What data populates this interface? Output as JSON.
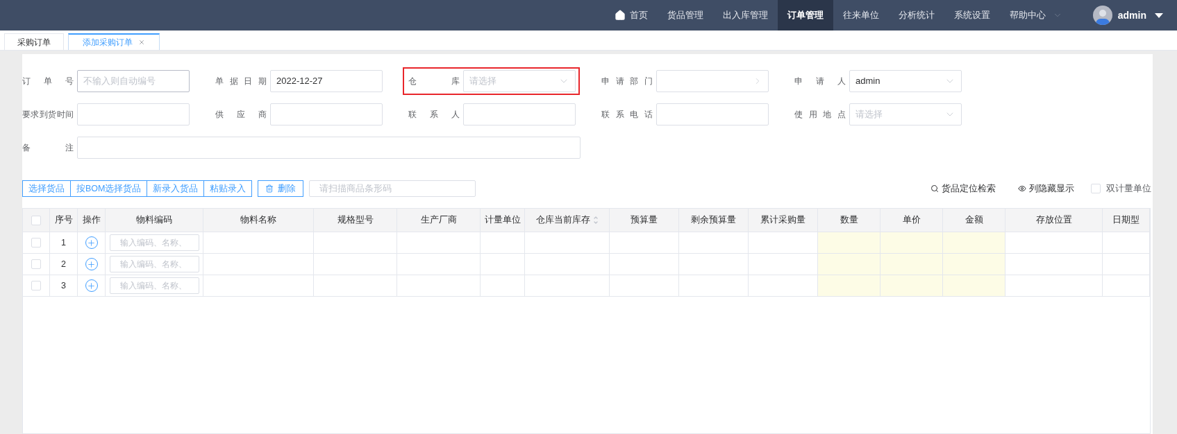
{
  "nav": {
    "items": [
      {
        "label": "首页",
        "kind": "home",
        "selected": false
      },
      {
        "label": "货品管理",
        "kind": "plain",
        "selected": false
      },
      {
        "label": "出入库管理",
        "kind": "plain",
        "selected": false
      },
      {
        "label": "订单管理",
        "kind": "plain",
        "selected": true
      },
      {
        "label": "往来单位",
        "kind": "plain",
        "selected": false
      },
      {
        "label": "分析统计",
        "kind": "plain",
        "selected": false
      },
      {
        "label": "系统设置",
        "kind": "plain",
        "selected": false
      },
      {
        "label": "帮助中心",
        "kind": "dropdown",
        "selected": false
      }
    ],
    "user": "admin"
  },
  "tabs": [
    {
      "label": "采购订单",
      "selected": false,
      "closable": false
    },
    {
      "label": "添加采购订单",
      "selected": true,
      "closable": true
    }
  ],
  "form": {
    "fields": [
      {
        "label": "订单号",
        "kind": "text",
        "placeholder": "不输入则自动编号",
        "highlighted": false
      },
      {
        "label": "单据日期",
        "kind": "text",
        "value": "2022-12-27",
        "highlighted": false
      },
      {
        "label": "仓库",
        "kind": "select",
        "placeholder": "请选择",
        "highlighted": true
      },
      {
        "label": "申请部门",
        "kind": "cascader",
        "highlighted": false
      },
      {
        "label": "申请人",
        "kind": "select",
        "value": "admin",
        "highlighted": false
      },
      {
        "label": "要求到货时间",
        "kind": "text",
        "highlighted": false
      },
      {
        "label": "供应商",
        "kind": "text",
        "highlighted": false
      },
      {
        "label": "联系人",
        "kind": "text",
        "highlighted": false
      },
      {
        "label": "联系电话",
        "kind": "text",
        "highlighted": false
      },
      {
        "label": "使用地点",
        "kind": "select",
        "placeholder": "请选择",
        "highlighted": false
      }
    ],
    "remark": {
      "label": "备注"
    }
  },
  "toolbar": {
    "buttons": [
      "选择货品",
      "按BOM选择货品",
      "新录入货品",
      "粘贴录入"
    ],
    "delete": "删除",
    "scan": {
      "placeholder": "请扫描商品条形码"
    },
    "locate": "货品定位检索",
    "columns_toggle": "列隐藏显示",
    "dual_unit": {
      "label": "双计量单位",
      "checked": false
    }
  },
  "table": {
    "select_all": {
      "checked": false
    },
    "columns": [
      {
        "label": "序号",
        "editable": false,
        "sortable": false
      },
      {
        "label": "操作",
        "editable": false,
        "sortable": false
      },
      {
        "label": "物料编码",
        "editable": false,
        "sortable": false
      },
      {
        "label": "物料名称",
        "editable": false,
        "sortable": false
      },
      {
        "label": "规格型号",
        "editable": false,
        "sortable": false
      },
      {
        "label": "生产厂商",
        "editable": false,
        "sortable": false
      },
      {
        "label": "计量单位",
        "editable": false,
        "sortable": false
      },
      {
        "label": "仓库当前库存",
        "editable": false,
        "sortable": true
      },
      {
        "label": "预算量",
        "editable": false,
        "sortable": false
      },
      {
        "label": "剩余预算量",
        "editable": false,
        "sortable": false
      },
      {
        "label": "累计采购量",
        "editable": false,
        "sortable": false
      },
      {
        "label": "数量",
        "editable": true,
        "sortable": false
      },
      {
        "label": "单价",
        "editable": true,
        "sortable": false
      },
      {
        "label": "金额",
        "editable": true,
        "sortable": false
      },
      {
        "label": "存放位置",
        "editable": false,
        "sortable": false
      },
      {
        "label": "日期型",
        "editable": false,
        "sortable": false
      }
    ],
    "rows": [
      {
        "index": "1",
        "checked": false,
        "code_placeholder": "输入编码、名称、"
      },
      {
        "index": "2",
        "checked": false,
        "code_placeholder": "输入编码、名称、"
      },
      {
        "index": "3",
        "checked": false,
        "code_placeholder": "输入编码、名称、"
      }
    ]
  }
}
